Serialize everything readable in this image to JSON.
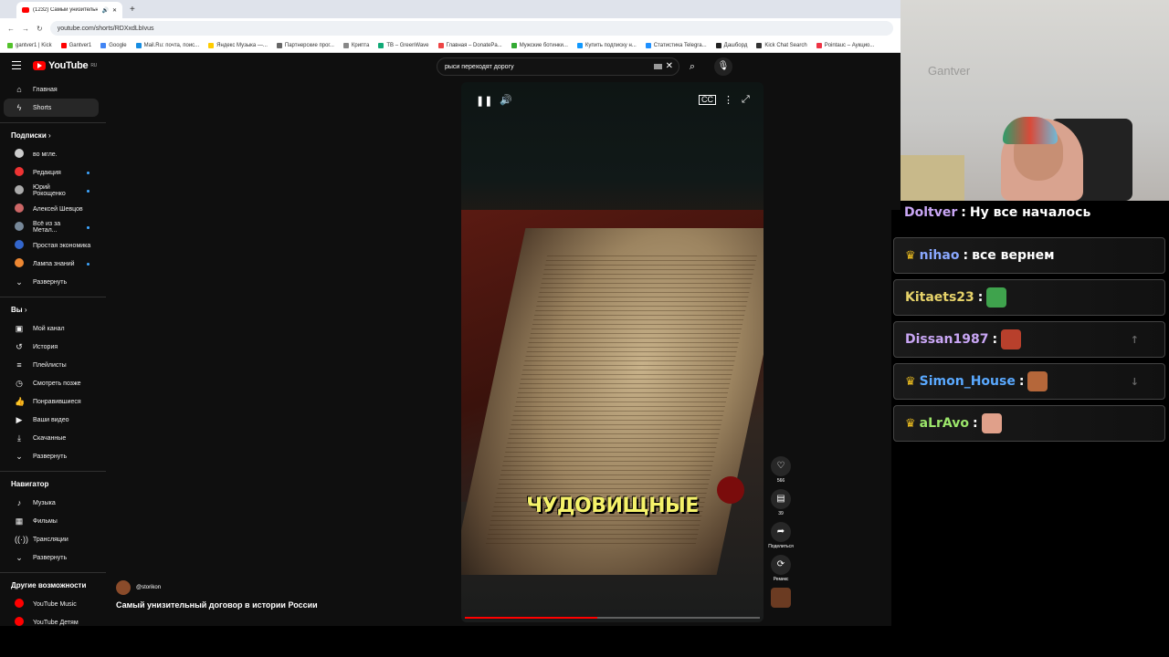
{
  "browser": {
    "tab_title": "(1232) Самый унизительн...",
    "url": "youtube.com/shorts/RDXxdLbIvus",
    "bookmarks": [
      "gantver1 | Kick",
      "Gantver1",
      "Google",
      "Mail.Ru: почта, поис...",
      "Яндекс Музыка —...",
      "Партнерские прог...",
      "Криптa",
      "TB – GreenWave",
      "Главная – DonatePa...",
      "Мужские ботинки...",
      "Купить подписку н...",
      "Статистика Telegra...",
      "Дашборд",
      "Kick Chat Search",
      "Pointauc – Аукцио..."
    ]
  },
  "youtube": {
    "logo": "YouTube",
    "logo_region": "RU",
    "search_value": "рыси переходят дорогу",
    "sidebar": {
      "main": [
        {
          "label": "Главная",
          "icon": "home-icon"
        },
        {
          "label": "Shorts",
          "icon": "shorts-icon"
        }
      ],
      "subscriptions_title": "Подписки",
      "subscriptions": [
        "во мгле.",
        "Редакция",
        "Юрий Рокощенко",
        "Алексей Шевцов",
        "Всё из за Метал...",
        "Простая экономика",
        "Лампа знаний",
        "Развернуть"
      ],
      "you_title": "Вы",
      "you": [
        "Мой канал",
        "История",
        "Плейлисты",
        "Смотреть позже",
        "Понравившиеся",
        "Ваши видео",
        "Скачанные",
        "Развернуть"
      ],
      "navigator_title": "Навигатор",
      "navigator": [
        "Музыка",
        "Фильмы",
        "Трансляции",
        "Развернуть"
      ],
      "other_title": "Другие возможности",
      "other": [
        "YouTube Music",
        "YouTube Детям"
      ]
    },
    "short": {
      "caption": "ЧУДОВИЩНЫЕ",
      "channel": "@storikon",
      "title": "Самый унизительный договор в истории России",
      "progress": 0.45,
      "likes": "566",
      "comments": "39",
      "share_label": "Поделиться",
      "remix_label": "Ремикс"
    }
  },
  "chat": {
    "top_partial": {
      "user": "Doltver",
      "text": "Ну все началось"
    },
    "messages": [
      {
        "user": "nihao",
        "text": "все вернем",
        "color": "#8aa8ff",
        "crown": true
      },
      {
        "user": "Kitaets23",
        "text": "",
        "color": "#e7d36a",
        "crown": false,
        "emote": "#3fa34d"
      },
      {
        "user": "Dissan1987",
        "text": "",
        "color": "#c9a6f5",
        "crown": false,
        "emote": "#b8402c"
      },
      {
        "user": "Simon_House",
        "text": "",
        "color": "#5aa9ff",
        "crown": true,
        "emote": "#b5673a"
      },
      {
        "user": "aLrAvo",
        "text": "",
        "color": "#9be56a",
        "crown": true,
        "emote": "#e0a08a"
      }
    ]
  },
  "webcam": {
    "watermark": "Gantver"
  }
}
